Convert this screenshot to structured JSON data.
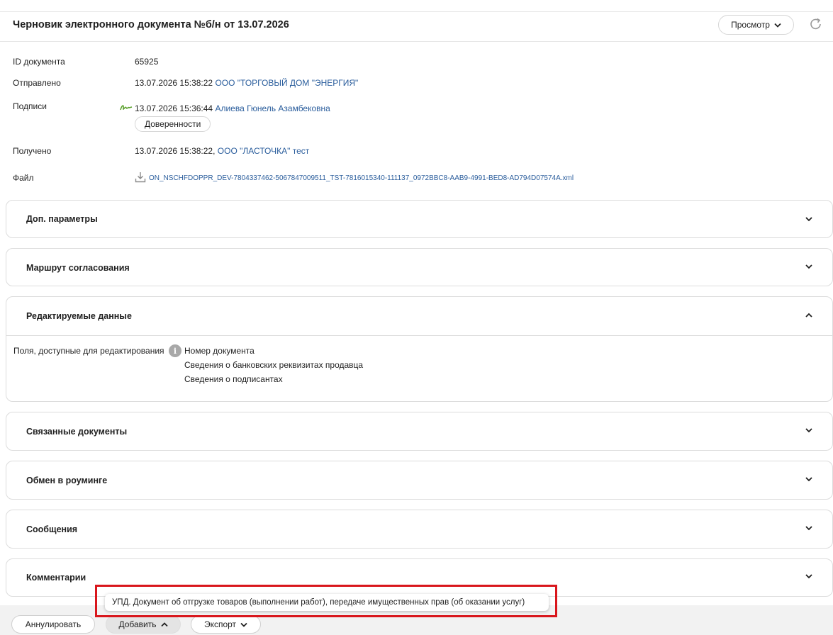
{
  "header": {
    "title": "Черновик электронного документа №б/н от 13.07.2026",
    "view_label": "Просмотр"
  },
  "info": {
    "id_label": "ID документа",
    "id_value": "65925",
    "sent_label": "Отправлено",
    "sent_time": "13.07.2026 15:38:22",
    "sent_org": "ООО \"ТОРГОВЫЙ ДОМ \"ЭНЕРГИЯ\"",
    "signatures_label": "Подписи",
    "sig_time": "13.07.2026 15:36:44",
    "sig_person": "Алиева Гюнель Азамбековна",
    "powers_button": "Доверенности",
    "received_label": "Получено",
    "received_time": "13.07.2026 15:38:22,",
    "received_org": "ООО \"ЛАСТОЧКА\" тест",
    "file_label": "Файл",
    "file_name": "ON_NSCHFDOPPR_DEV-7804337462-5067847009511_TST-7816015340-111137_0972BBC8-AAB9-4991-BED8-AD794D07574A.xml"
  },
  "sections": {
    "extra_params": "Доп. параметры",
    "approval_route": "Маршрут согласования",
    "editable_data": "Редактируемые данные",
    "related_docs": "Связанные документы",
    "roaming": "Обмен в роуминге",
    "messages": "Сообщения",
    "comments": "Комментарии"
  },
  "editable": {
    "label": "Поля, доступные для редактирования",
    "items": [
      "Номер документа",
      "Сведения о банковских реквизитах продавца",
      "Сведения о подписантах"
    ]
  },
  "footer": {
    "annul": "Аннулировать",
    "add": "Добавить",
    "export": "Экспорт"
  },
  "tooltip": "УПД. Документ об отгрузке товаров (выполнении работ), передаче имущественных прав (об оказании услуг)",
  "colors": {
    "link": "#2a5d9c",
    "highlight": "#d9161c",
    "signature_green": "#5aa02c"
  }
}
